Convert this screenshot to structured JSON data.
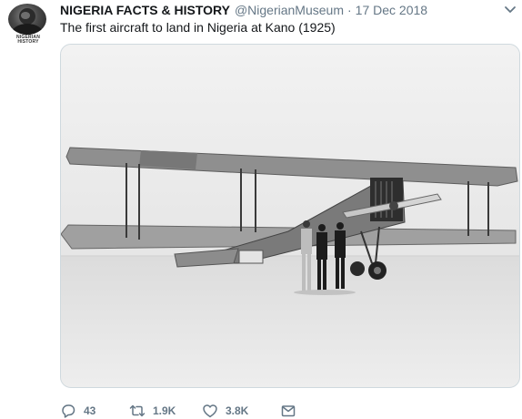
{
  "account": {
    "display_name": "NIGERIA FACTS & HISTORY",
    "handle": "@NigerianMuseum",
    "separator": "·",
    "date": "17 Dec 2018",
    "avatar_label": "NIGERIAN HISTORY",
    "avatar_icon": "profile-photo"
  },
  "tweet": {
    "text": "The first aircraft to land in Nigeria at Kano (1925)"
  },
  "media": {
    "description_icon": "photo-biplane"
  },
  "actions": {
    "reply_count": "43",
    "retweet_count": "1.9K",
    "like_count": "3.8K",
    "reply_icon": "reply-icon",
    "retweet_icon": "retweet-icon",
    "like_icon": "heart-icon",
    "dm_icon": "envelope-icon"
  },
  "colors": {
    "text_primary": "#14171a",
    "text_secondary": "#657786",
    "border": "#cfd9de"
  }
}
